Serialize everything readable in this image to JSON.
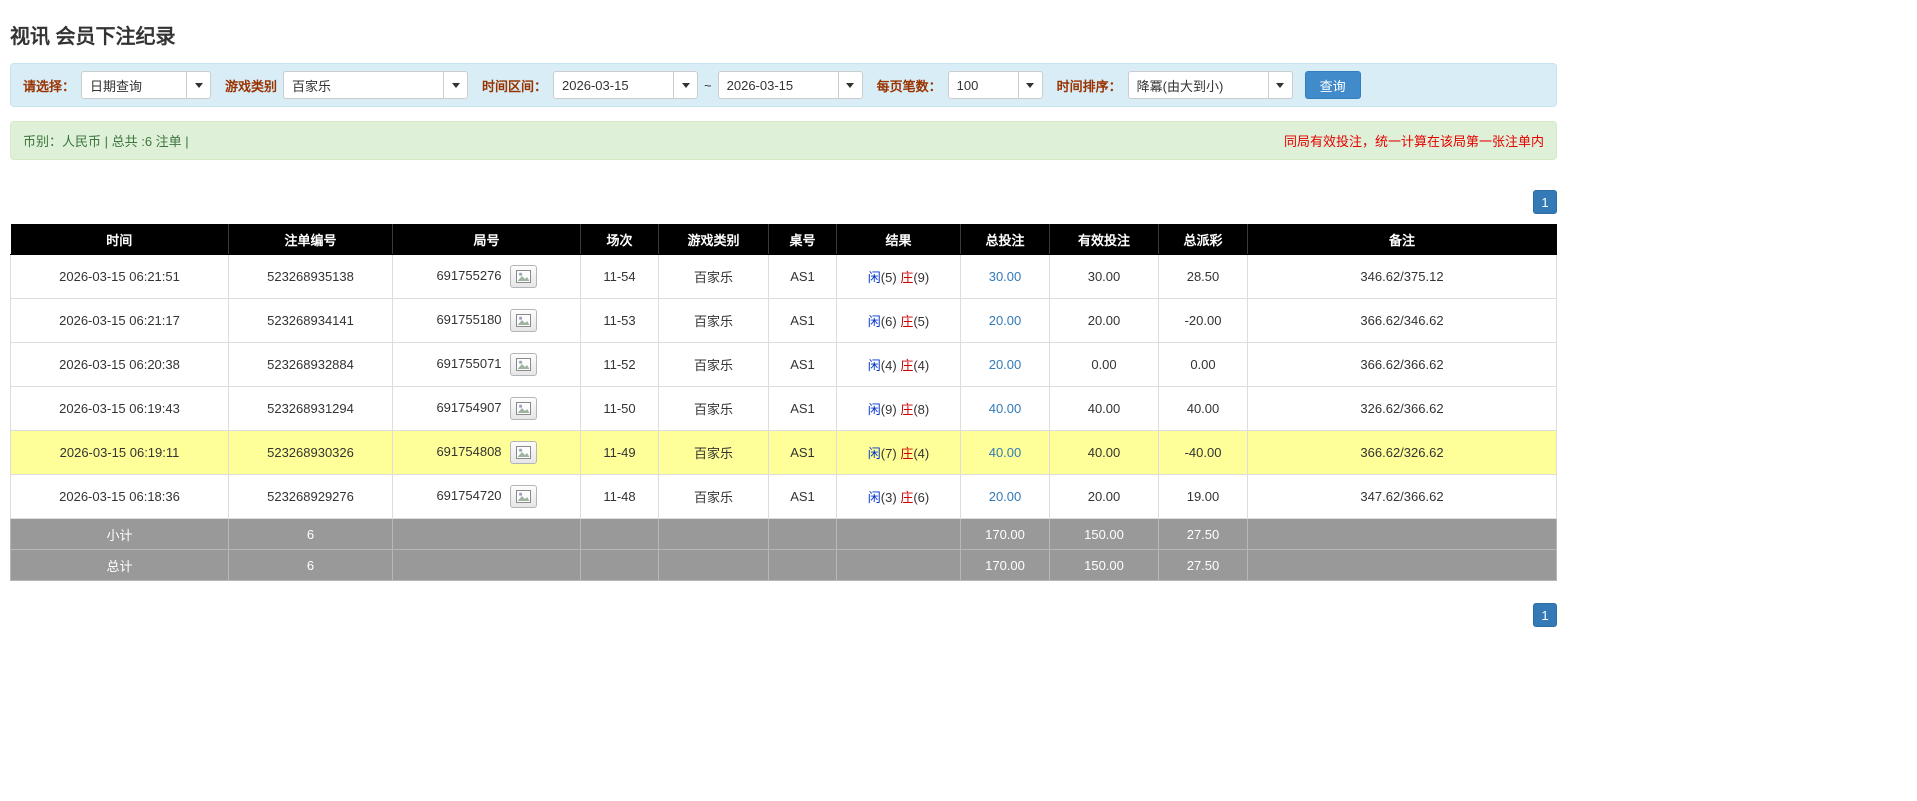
{
  "colors": {
    "accent_blue": "#337ab7",
    "button_blue": "#428bca",
    "label_red": "#993300",
    "player_blue": "#0033cc",
    "banker_red": "#cc0000",
    "negative_red": "#ee0000",
    "highlight_yellow": "#ffff99",
    "header_bg": "#000000",
    "footer_gray": "#999999",
    "filterbar_bg": "#d9edf7",
    "infobar_bg": "#dff0d8",
    "infobar_text": "#3c763d",
    "notice_red": "#e60000"
  },
  "page": {
    "title": "视讯 会员下注纪录"
  },
  "filters": {
    "select_label": "请选择：",
    "select_value": "日期查询",
    "game_type_label": "游戏类别",
    "game_type_value": "百家乐",
    "date_range_label": "时间区间：",
    "date_from": "2026-03-15",
    "date_separator": "~",
    "date_to": "2026-03-15",
    "page_size_label": "每页笔数：",
    "page_size_value": "100",
    "sort_label": "时间排序：",
    "sort_value": "降冪(由大到小)",
    "search_button": "查询"
  },
  "info_bar": {
    "left": "币别：人民币 | 总共 :6 注单 |",
    "right": "同局有效投注，统一计算在该局第一张注单内"
  },
  "pagination": {
    "page": "1"
  },
  "table": {
    "headers": [
      "时间",
      "注单编号",
      "局号",
      "场次",
      "游戏类别",
      "桌号",
      "结果",
      "总投注",
      "有效投注",
      "总派彩",
      "备注"
    ],
    "round_icon": "image-icon",
    "rows": [
      {
        "time": "2026-03-15 06:21:51",
        "bet_id": "523268935138",
        "round_id": "691755276",
        "session": "11-54",
        "game": "百家乐",
        "table_no": "AS1",
        "result": {
          "player_label": "闲",
          "player_num": "(5)",
          "banker_label": "庄",
          "banker_num": "(9)"
        },
        "total_bet": "30.00",
        "valid_bet": "30.00",
        "payout": "28.50",
        "remark": "346.62/375.12",
        "highlight": false
      },
      {
        "time": "2026-03-15 06:21:17",
        "bet_id": "523268934141",
        "round_id": "691755180",
        "session": "11-53",
        "game": "百家乐",
        "table_no": "AS1",
        "result": {
          "player_label": "闲",
          "player_num": "(6)",
          "banker_label": "庄",
          "banker_num": "(5)"
        },
        "total_bet": "20.00",
        "valid_bet": "20.00",
        "payout": "-20.00",
        "remark": "366.62/346.62",
        "highlight": false
      },
      {
        "time": "2026-03-15 06:20:38",
        "bet_id": "523268932884",
        "round_id": "691755071",
        "session": "11-52",
        "game": "百家乐",
        "table_no": "AS1",
        "result": {
          "player_label": "闲",
          "player_num": "(4)",
          "banker_label": "庄",
          "banker_num": "(4)"
        },
        "total_bet": "20.00",
        "valid_bet": "0.00",
        "payout": "0.00",
        "remark": "366.62/366.62",
        "highlight": false
      },
      {
        "time": "2026-03-15 06:19:43",
        "bet_id": "523268931294",
        "round_id": "691754907",
        "session": "11-50",
        "game": "百家乐",
        "table_no": "AS1",
        "result": {
          "player_label": "闲",
          "player_num": "(9)",
          "banker_label": "庄",
          "banker_num": "(8)"
        },
        "total_bet": "40.00",
        "valid_bet": "40.00",
        "payout": "40.00",
        "remark": "326.62/366.62",
        "highlight": false
      },
      {
        "time": "2026-03-15 06:19:11",
        "bet_id": "523268930326",
        "round_id": "691754808",
        "session": "11-49",
        "game": "百家乐",
        "table_no": "AS1",
        "result": {
          "player_label": "闲",
          "player_num": "(7)",
          "banker_label": "庄",
          "banker_num": "(4)"
        },
        "total_bet": "40.00",
        "valid_bet": "40.00",
        "payout": "-40.00",
        "remark": "366.62/326.62",
        "highlight": true
      },
      {
        "time": "2026-03-15 06:18:36",
        "bet_id": "523268929276",
        "round_id": "691754720",
        "session": "11-48",
        "game": "百家乐",
        "table_no": "AS1",
        "result": {
          "player_label": "闲",
          "player_num": "(3)",
          "banker_label": "庄",
          "banker_num": "(6)"
        },
        "total_bet": "20.00",
        "valid_bet": "20.00",
        "payout": "19.00",
        "remark": "347.62/366.62",
        "highlight": false
      }
    ],
    "footer_rows": [
      {
        "label": "小计",
        "count": "6",
        "total_bet": "170.00",
        "valid_bet": "150.00",
        "payout": "27.50"
      },
      {
        "label": "总计",
        "count": "6",
        "total_bet": "170.00",
        "valid_bet": "150.00",
        "payout": "27.50"
      }
    ]
  }
}
